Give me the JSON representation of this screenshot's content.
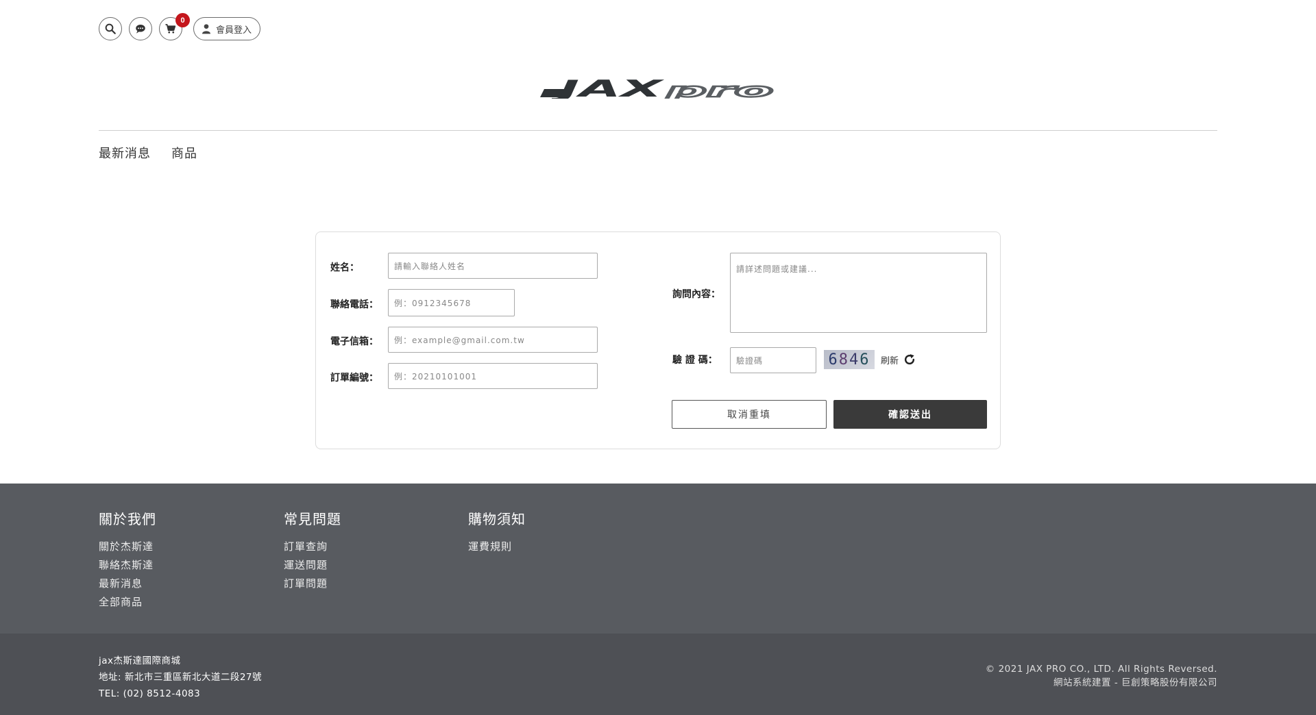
{
  "header": {
    "cart_count": "0",
    "login_label": "會員登入",
    "logo_text": "JAXpro"
  },
  "nav": [
    {
      "label": "最新消息"
    },
    {
      "label": "商品"
    }
  ],
  "form": {
    "name_label": "姓名：",
    "name_placeholder": "請輸入聯絡人姓名",
    "phone_label": "聯絡電話：",
    "phone_placeholder": "例：0912345678",
    "email_label": "電子信箱：",
    "email_placeholder": "例：example@gmail.com.tw",
    "order_label": "訂單編號：",
    "order_placeholder": "例：20210101001",
    "inquiry_label": "詢問內容：",
    "inquiry_placeholder": "請詳述問題或建議...",
    "captcha_label": "驗 證 碼：",
    "captcha_placeholder": "驗證碼",
    "captcha_digits": [
      "6",
      "8",
      "4",
      "6"
    ],
    "refresh_label": "刷新",
    "cancel_label": "取消重填",
    "submit_label": "確認送出"
  },
  "footer": {
    "columns": [
      {
        "title": "關於我們",
        "links": [
          "關於杰斯達",
          "聯絡杰斯達",
          "最新消息",
          "全部商品"
        ]
      },
      {
        "title": "常見問題",
        "links": [
          "訂單查詢",
          "運送問題",
          "訂單問題"
        ]
      },
      {
        "title": "購物須知",
        "links": [
          "運費規則"
        ]
      }
    ],
    "company_name": "jax杰斯達國際商城",
    "address": "地址: 新北市三重區新北大道二段27號",
    "tel": "TEL: (02) 8512-4083",
    "copyright": "© 2021 JAX PRO CO., LTD. All Rights Reversed.",
    "credit": "網站系統建置 - 巨創策略股份有限公司"
  },
  "colors": {
    "badge": "#c4161c",
    "footer_top": "#585b60",
    "footer_bottom": "#4e5055",
    "submit_button": "#3a3a3a"
  }
}
